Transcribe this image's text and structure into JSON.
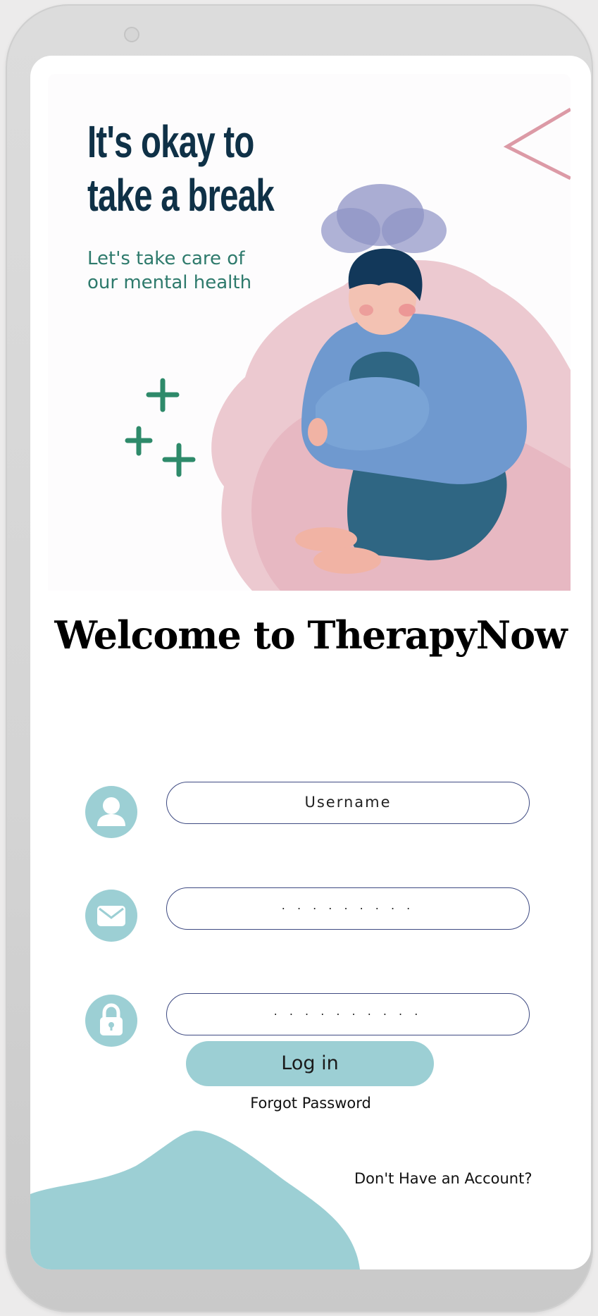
{
  "banner": {
    "headline_line1": "It's okay to",
    "headline_line2": "take a break",
    "subhead_line1": "Let's take care of",
    "subhead_line2": "our mental health"
  },
  "welcome": "Welcome to TherapyNow",
  "form": {
    "username_placeholder": "Username",
    "email_value": ". . . . . . . . .",
    "password_value": ". . . . . . . . . .",
    "login_label": "Log in",
    "forgot_label": "Forgot Password",
    "account_label": "Don't Have an Account?"
  },
  "icons": {
    "username": "user-icon",
    "email": "envelope-icon",
    "password": "lock-icon"
  },
  "colors": {
    "accent": "#9ccfd4",
    "headline": "#0f3147",
    "subhead": "#2e7a6c",
    "field_border": "#3e4a82"
  }
}
